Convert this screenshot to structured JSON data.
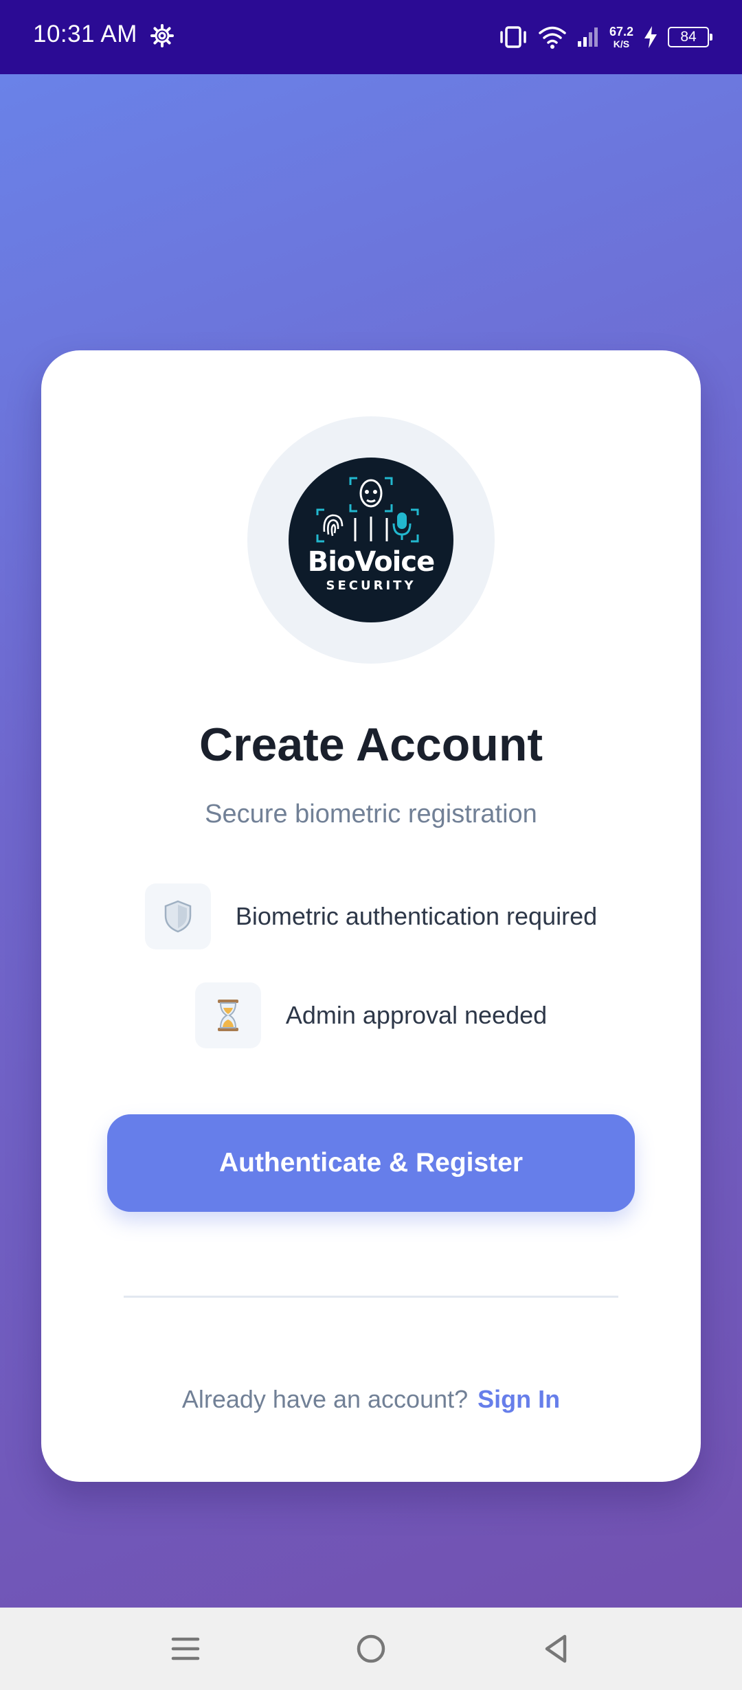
{
  "status_bar": {
    "time": "10:31 AM",
    "net_speed_value": "67.2",
    "net_speed_unit": "K/S",
    "battery": "84"
  },
  "logo": {
    "brand_name": "BioVoice",
    "brand_tagline": "SECURITY"
  },
  "page": {
    "title": "Create Account",
    "subtitle": "Secure biometric registration"
  },
  "features": [
    {
      "icon": "shield-icon",
      "label": "Biometric authentication required"
    },
    {
      "icon": "hourglass-icon",
      "label": "Admin approval needed"
    }
  ],
  "actions": {
    "register_button": "Authenticate & Register"
  },
  "footer": {
    "prompt": "Already have an account?",
    "signin_link": "Sign In"
  },
  "colors": {
    "status_bar": "#2b0b94",
    "accent": "#667eea",
    "title": "#1a202c",
    "muted": "#718096",
    "logo_cyan": "#22b8cf",
    "logo_dark": "#0d1b2a"
  }
}
